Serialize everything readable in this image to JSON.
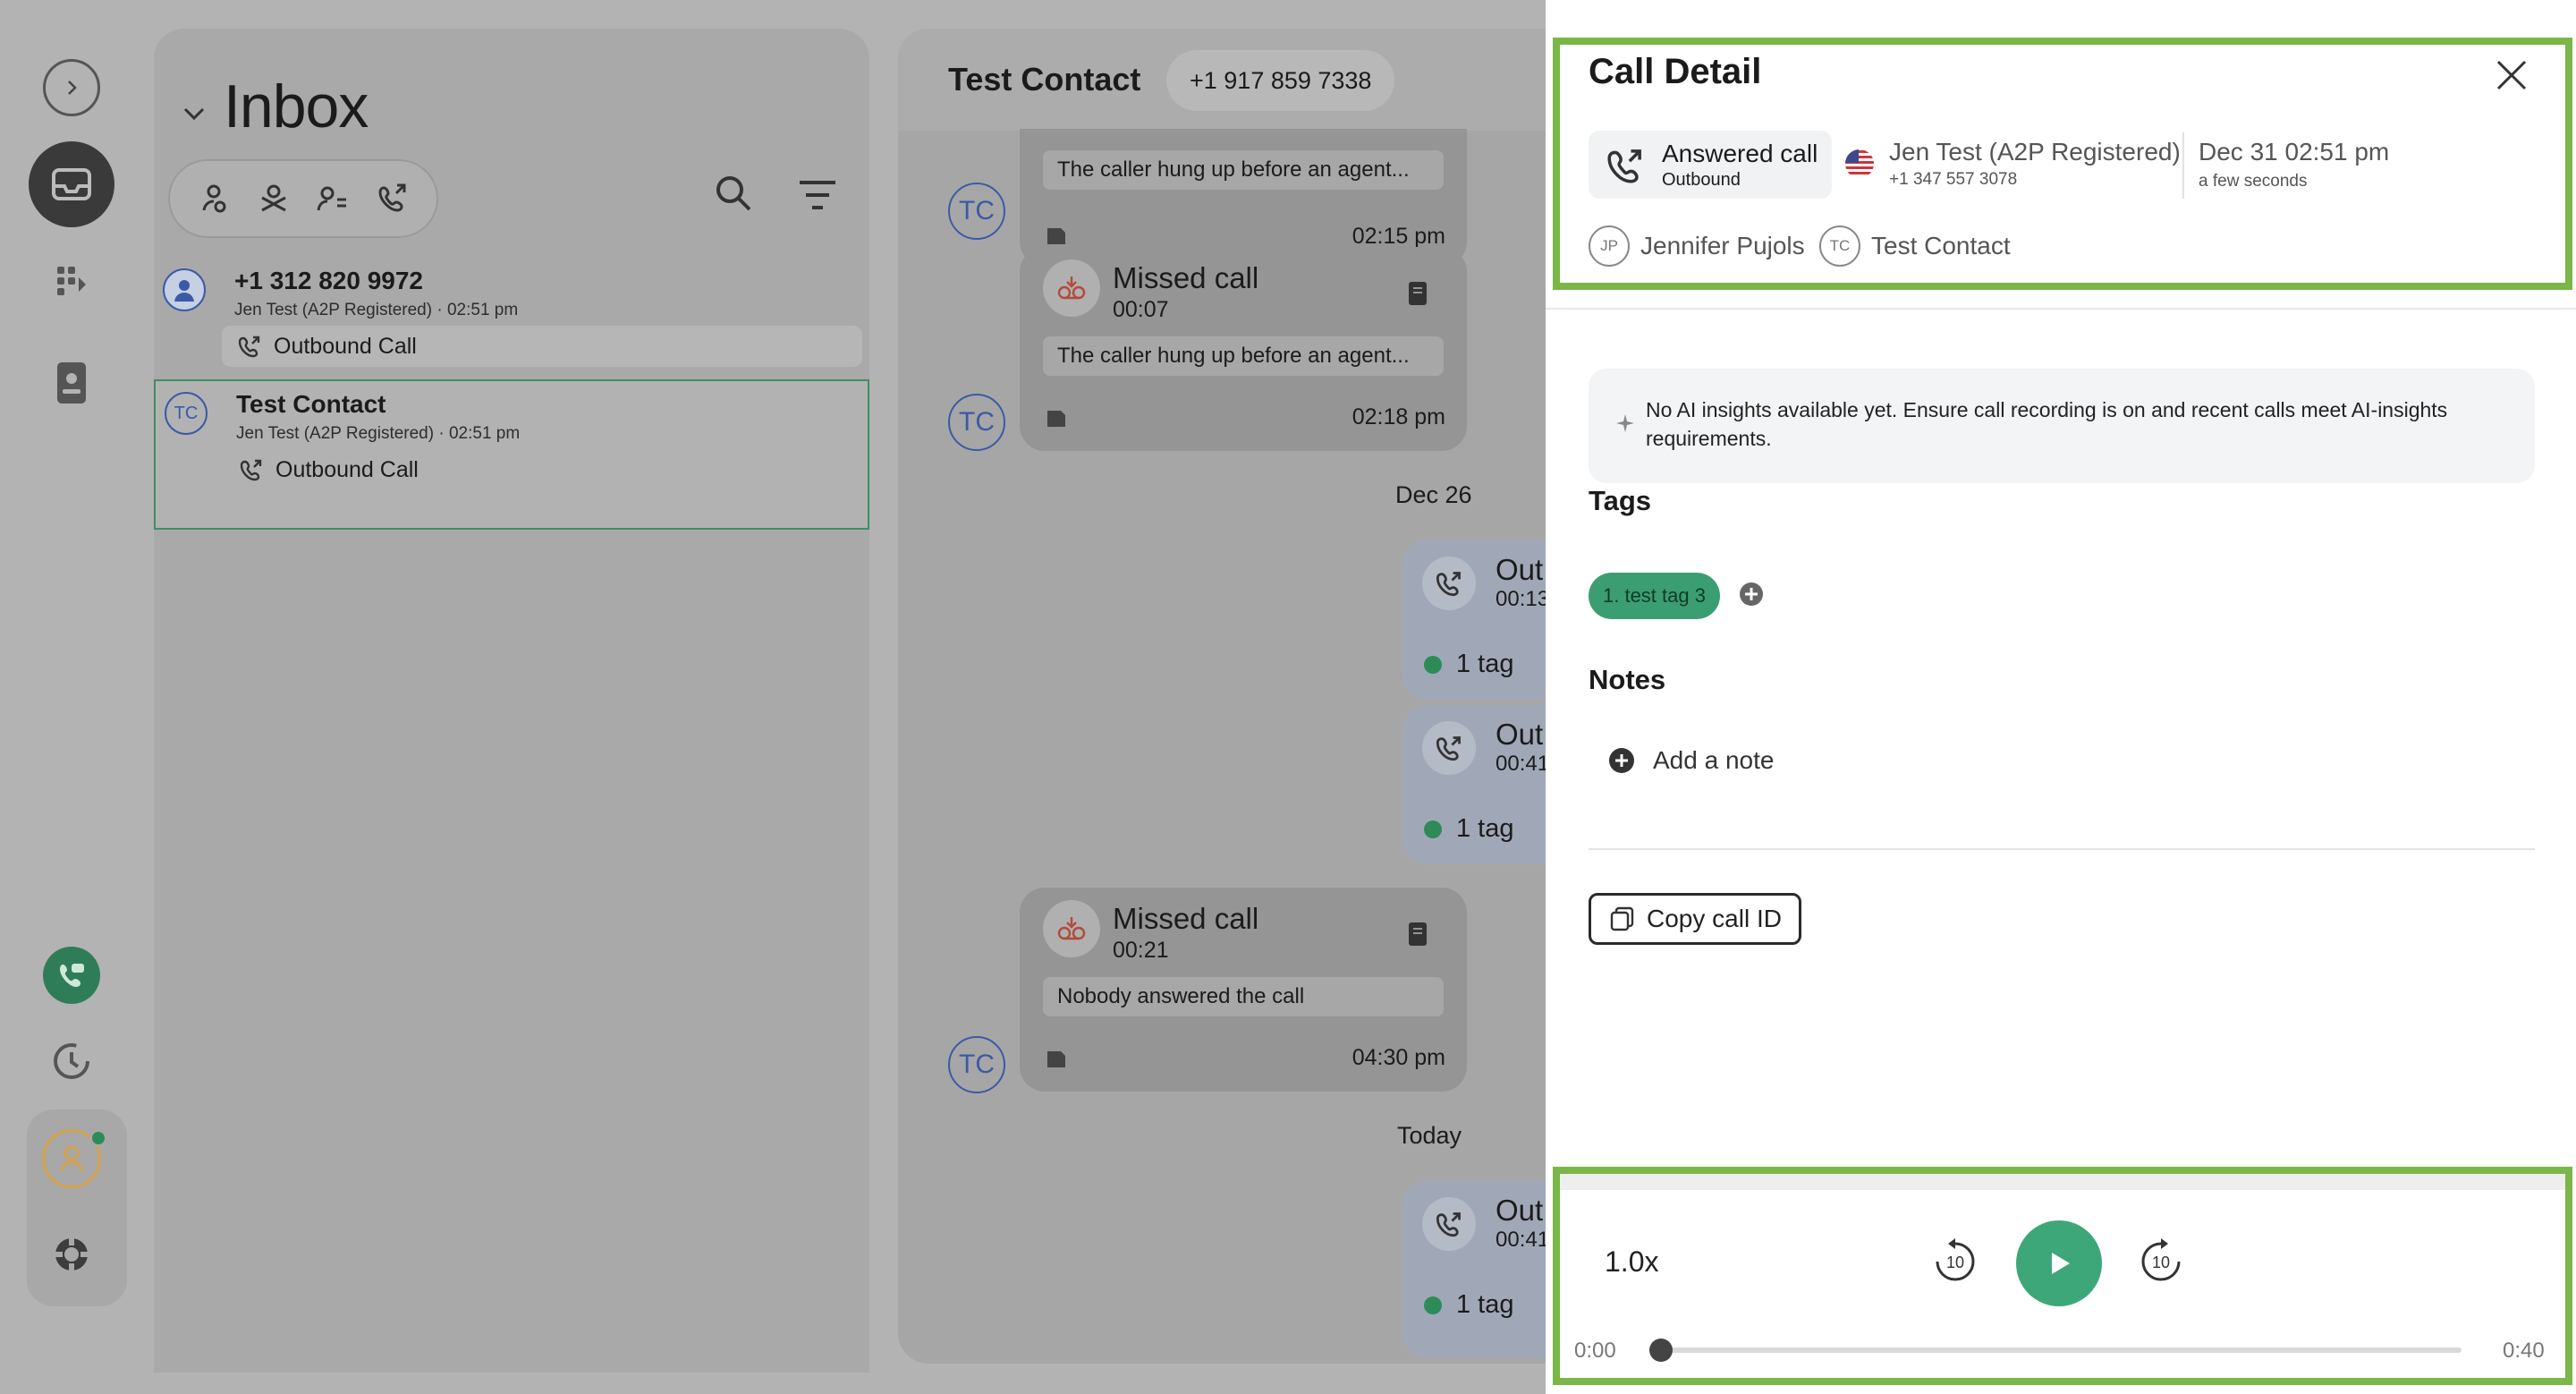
{
  "rail": {
    "items": [
      "expand-icon",
      "inbox-icon",
      "dialpad-icon",
      "contacts-icon",
      "phone-chat-icon",
      "history-icon",
      "profile-icon",
      "help-icon"
    ]
  },
  "inbox": {
    "title": "Inbox",
    "conversations": [
      {
        "name": "+1 312 820 9972",
        "sub": "Jen Test (A2P Registered)   · 02:51 pm",
        "last": "Outbound Call",
        "avatar": ""
      },
      {
        "name": "Test Contact",
        "sub": "Jen Test (A2P Registered)   · 02:51 pm",
        "last": "Outbound Call",
        "avatar": "TC"
      }
    ]
  },
  "chat": {
    "contact": "Test Contact",
    "phone": "+1 917 859 7338",
    "avatar": "TC",
    "messages": [
      {
        "note": "The caller hung up before an agent...",
        "time": "02:15 pm"
      },
      {
        "title": "Missed call",
        "duration": "00:07",
        "note": "The caller hung up before an agent...",
        "time": "02:18 pm"
      },
      {
        "title": "Missed call",
        "duration": "00:21",
        "note": "Nobody answered the call",
        "time": "04:30 pm"
      }
    ],
    "dates": [
      "Dec 26",
      "Today"
    ],
    "outbound": [
      {
        "title": "Out",
        "duration": "00:13",
        "tag": "1 tag"
      },
      {
        "title": "Out",
        "duration": "00:41",
        "tag": "1 tag"
      },
      {
        "title": "Out",
        "duration": "00:41",
        "tag": "1 tag"
      }
    ]
  },
  "detail": {
    "title": "Call Detail",
    "call_status": "Answered call",
    "direction": "Outbound",
    "line_name": "Jen Test (A2P Registered)",
    "line_number": "+1 347 557 3078",
    "date": "Dec 31 02:51 pm",
    "relative": "a few seconds",
    "agent": {
      "initials": "JP",
      "name": "Jennifer Pujols"
    },
    "contact": {
      "initials": "TC",
      "name": "Test Contact"
    },
    "ai_message": "No AI insights available yet. Ensure call recording is on and recent calls meet AI-insights requirements.",
    "tags_heading": "Tags",
    "tag": "1. test tag 3",
    "notes_heading": "Notes",
    "add_note": "Add a note",
    "copy_id": "Copy call ID"
  },
  "player": {
    "speed": "1.0x",
    "skip_back": "10",
    "skip_forward": "10",
    "time_start": "0:00",
    "time_end": "0:40",
    "progress": 0
  },
  "colors": {
    "accent": "#3ea77a",
    "highlight": "#7ab648",
    "tag": "#3b9e72",
    "contact_blue": "#3b5aa6"
  }
}
